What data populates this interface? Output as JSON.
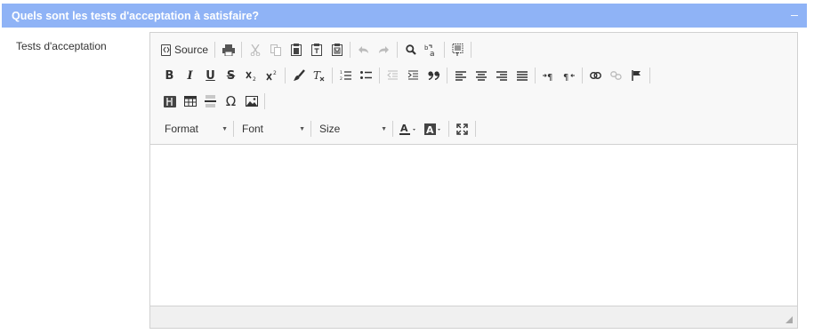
{
  "panel": {
    "title": "Quels sont les tests d'acceptation à satisfaire?",
    "collapse_symbol": "–"
  },
  "field": {
    "label": "Tests d'acceptation"
  },
  "editor": {
    "source_label": "Source",
    "format_label": "Format",
    "font_label": "Font",
    "size_label": "Size",
    "bold_glyph": "B",
    "italic_glyph": "I",
    "underline_glyph": "U",
    "strike_glyph": "S",
    "omega_glyph": "Ω",
    "content": ""
  },
  "colors": {
    "header_bg": "#8fb3f6",
    "toolbar_bg": "#f8f8f8",
    "border": "#d1d1d1"
  }
}
